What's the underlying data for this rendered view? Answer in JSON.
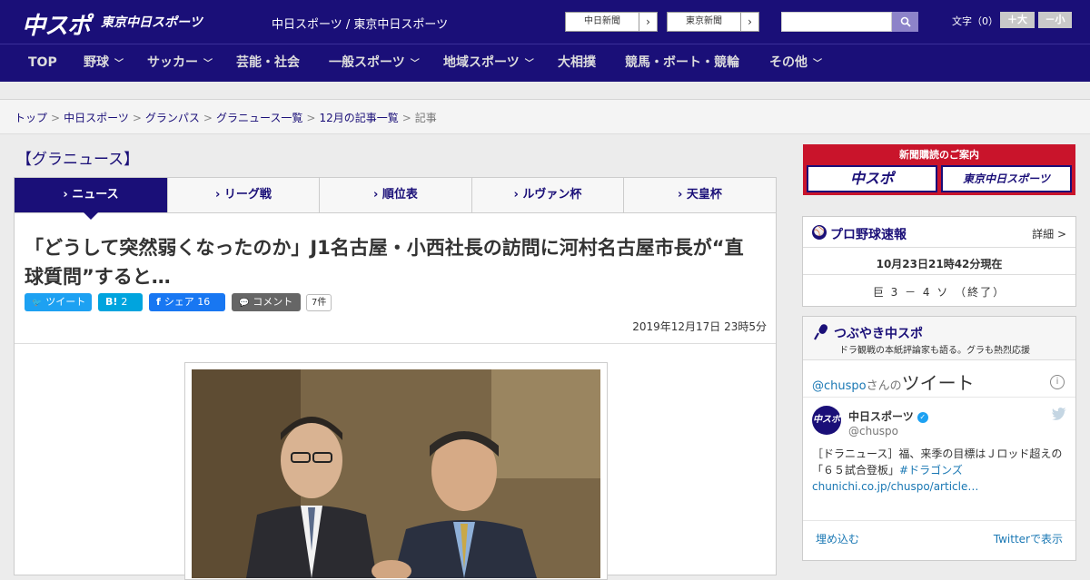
{
  "header": {
    "logo_main": "中スポ",
    "logo_tokyo": "東京中日スポーツ",
    "tagline": "中日スポーツ / 東京中日スポーツ",
    "ext_links": [
      {
        "label": "中日新聞",
        "arrow": "›"
      },
      {
        "label": "東京新聞",
        "arrow": "›"
      }
    ],
    "search_placeholder": "",
    "fontsize_label": "文字（0）",
    "fontsize_up": "＋大",
    "fontsize_down": "－小"
  },
  "nav": {
    "items": [
      {
        "label": "TOP",
        "chevron": ""
      },
      {
        "label": "野球",
        "chevron": "﹀"
      },
      {
        "label": "サッカー",
        "chevron": "﹀"
      },
      {
        "label": "芸能・社会",
        "chevron": ""
      },
      {
        "label": "一般スポーツ",
        "chevron": "﹀"
      },
      {
        "label": "地域スポーツ",
        "chevron": "﹀"
      },
      {
        "label": "大相撲",
        "chevron": ""
      },
      {
        "label": "競馬・ボート・競輪",
        "chevron": ""
      },
      {
        "label": "その他",
        "chevron": "﹀"
      }
    ]
  },
  "breadcrumb": {
    "items": [
      "トップ",
      "中日スポーツ",
      "グランパス",
      "グラニュース一覧",
      "12月の記事一覧"
    ],
    "current": "記事",
    "separator": ">"
  },
  "section_title": "【グラニュース】",
  "tabs": [
    {
      "label": "› ニュース"
    },
    {
      "label": "› リーグ戦"
    },
    {
      "label": "› 順位表"
    },
    {
      "label": "› ルヴァン杯"
    },
    {
      "label": "› 天皇杯"
    }
  ],
  "article": {
    "headline": "「どうして突然弱くなったのか」J1名古屋・小西社長の訪問に河村名古屋市長が“直球質問”すると…",
    "share": {
      "tweet": "ツイート",
      "tweet_icon": "🐦",
      "hatena_icon": "B!",
      "hatena_count": "2",
      "fb_icon": "f",
      "fb_label": "シェア 16",
      "comment_icon": "💬",
      "comment_label": "コメント",
      "comment_count": "7件"
    },
    "date": "2019年12月17日 23時5分"
  },
  "sidebar": {
    "subscribe": {
      "title": "新聞購読のご案内",
      "left": "中スポ",
      "right": "東京中日スポーツ"
    },
    "baseball": {
      "icon": "⚾",
      "title": "プロ野球速報",
      "detail": "詳細 >",
      "time": "10月23日21時42分現在",
      "score": "巨 3 － 4 ソ （終了）"
    },
    "twitter": {
      "title": "つぶやき中スポ",
      "subtitle": "ドラ観戦の本紙評論家も語る。グラも熱烈応援",
      "handle_prefix": "@chuspo",
      "handle_suffix": "さんの",
      "heading": "ツイート",
      "info": "i",
      "account_name": "中日スポーツ",
      "account_handle": "@chuspo",
      "avatar_text": "中スポ",
      "tweet_text": "［ドラニュース］福、来季の目標はＪロッド超えの「６５試合登板」",
      "tweet_hashtag": "#ドラゴンズ",
      "tweet_link": "chunichi.co.jp/chuspo/article…",
      "embed": "埋め込む",
      "view_on": "Twitterで表示"
    }
  },
  "colors": {
    "brand_navy": "#1a0f78",
    "twitter_blue": "#1da1f2",
    "hatena_blue": "#00a4de",
    "facebook_blue": "#1877f2",
    "comment_gray": "#666666",
    "subscribe_red": "#c9142b"
  }
}
